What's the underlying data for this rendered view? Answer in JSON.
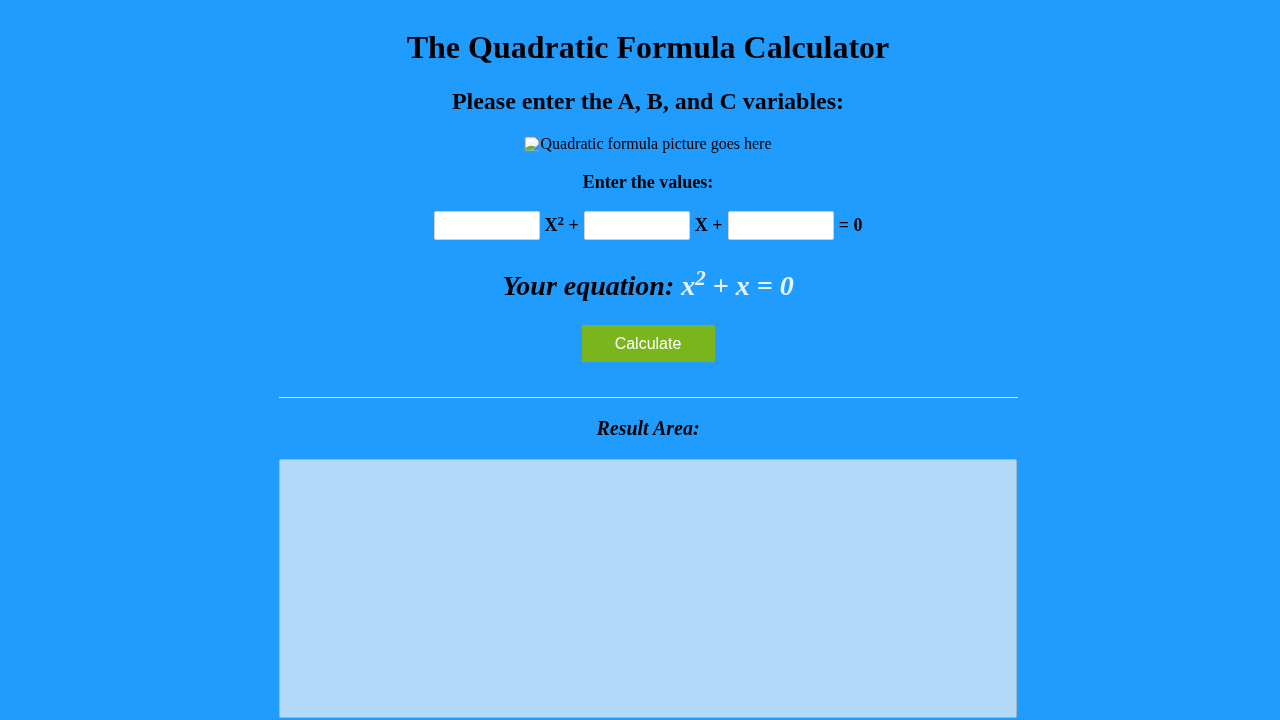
{
  "title": "The Quadratic Formula Calculator",
  "subtitle": "Please enter the A, B, and C variables:",
  "image": {
    "alt_text": "Quadratic formula picture goes here"
  },
  "values_label": "Enter the values:",
  "equation_row": [
    {
      "kind": "field"
    },
    {
      "kind": "term",
      "text": "X$^{2}$ +"
    },
    {
      "kind": "field"
    },
    {
      "kind": "term",
      "text": "X +"
    },
    {
      "kind": "field"
    },
    {
      "kind": "term",
      "text": "= 0"
    }
  ],
  "equation": {
    "label": "Your equation:",
    "value": "x$^{2}$ + x = 0"
  },
  "button": {
    "label": "Calculate"
  },
  "result": {
    "label": "Result Area:"
  }
}
